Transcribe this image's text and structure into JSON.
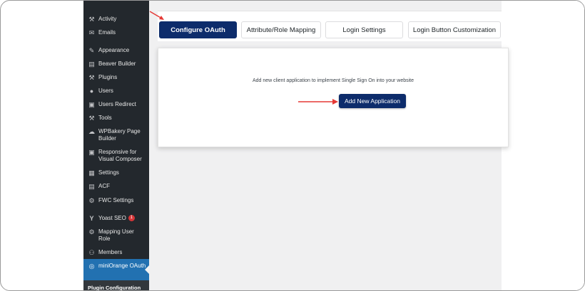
{
  "sidebar": {
    "items": [
      {
        "label": "Activity",
        "icon": "activity-icon",
        "glyph": "⚒"
      },
      {
        "label": "Emails",
        "icon": "email-icon",
        "glyph": "✉"
      },
      {
        "label": "Appearance",
        "icon": "paintbrush-icon",
        "glyph": "✎"
      },
      {
        "label": "Beaver Builder",
        "icon": "layout-icon",
        "glyph": "▤"
      },
      {
        "label": "Plugins",
        "icon": "plugin-icon",
        "glyph": "⚒"
      },
      {
        "label": "Users",
        "icon": "user-icon",
        "glyph": "●"
      },
      {
        "label": "Users Redirect",
        "icon": "redirect-icon",
        "glyph": "▣"
      },
      {
        "label": "Tools",
        "icon": "wrench-icon",
        "glyph": "⚒"
      },
      {
        "label": "WPBakery Page Builder",
        "icon": "cloud-icon",
        "glyph": "☁"
      },
      {
        "label": "Responsive for Visual Composer",
        "icon": "responsive-icon",
        "glyph": "▣"
      },
      {
        "label": "Settings",
        "icon": "settings-icon",
        "glyph": "▦"
      },
      {
        "label": "ACF",
        "icon": "acf-icon",
        "glyph": "▤"
      },
      {
        "label": "FWC Settings",
        "icon": "gear-icon",
        "glyph": "⚙"
      },
      {
        "label": "Yoast SEO",
        "icon": "yoast-icon",
        "glyph": "Y",
        "badge": "1"
      },
      {
        "label": "Mapping User Role",
        "icon": "gear-icon",
        "glyph": "⚙"
      },
      {
        "label": "Members",
        "icon": "members-icon",
        "glyph": "⚇"
      },
      {
        "label": "miniOrange OAuth",
        "icon": "miniorange-icon",
        "glyph": "◎",
        "active": true
      }
    ],
    "sub_label": "Plugin Configuration"
  },
  "tabs": [
    {
      "label": "Configure OAuth",
      "active": true
    },
    {
      "label": "Attribute/Role Mapping"
    },
    {
      "label": "Login Settings"
    },
    {
      "label": "Login Button Customization"
    }
  ],
  "card": {
    "description": "Add new client application to implement Single Sign On into your website",
    "button_label": "Add New Application"
  },
  "colors": {
    "sidebar_bg": "#23282d",
    "active_bg": "#2271b1",
    "primary": "#0d2c6b",
    "annotation_arrow": "#e53935",
    "badge": "#d63638"
  }
}
